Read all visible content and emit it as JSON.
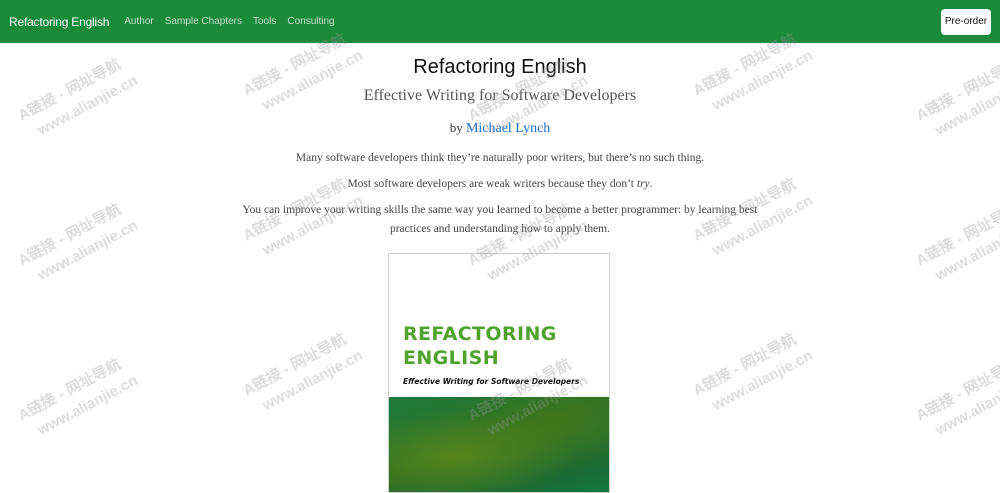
{
  "nav": {
    "brand": "Refactoring English",
    "links": [
      "Author",
      "Sample Chapters",
      "Tools",
      "Consulting"
    ],
    "preorder_label": "Pre-order"
  },
  "hero": {
    "title": "Refactoring English",
    "subtitle": "Effective Writing for Software Developers",
    "by_prefix": "by",
    "author": "Michael Lynch"
  },
  "intro": {
    "p1": "Many software developers think they’re naturally poor writers, but there’s no such thing.",
    "p2_before": "Most software developers are weak writers because they don’t ",
    "p2_emph": "try",
    "p2_after": ".",
    "p3": "You can improve your writing skills the same way you learned to become a better programmer: by learning best practices and understanding how to apply them."
  },
  "cover": {
    "title_line1": "REFACTORING",
    "title_line2": "ENGLISH",
    "subtitle": "Effective Writing for Software Developers"
  },
  "watermark": {
    "line1": "A链接 - 网址导航",
    "line2": "www.alianjie.cn"
  },
  "colors": {
    "navbar": "#1b8a3a",
    "link": "#1a6fd1",
    "cover_title": "#4fa32d"
  }
}
